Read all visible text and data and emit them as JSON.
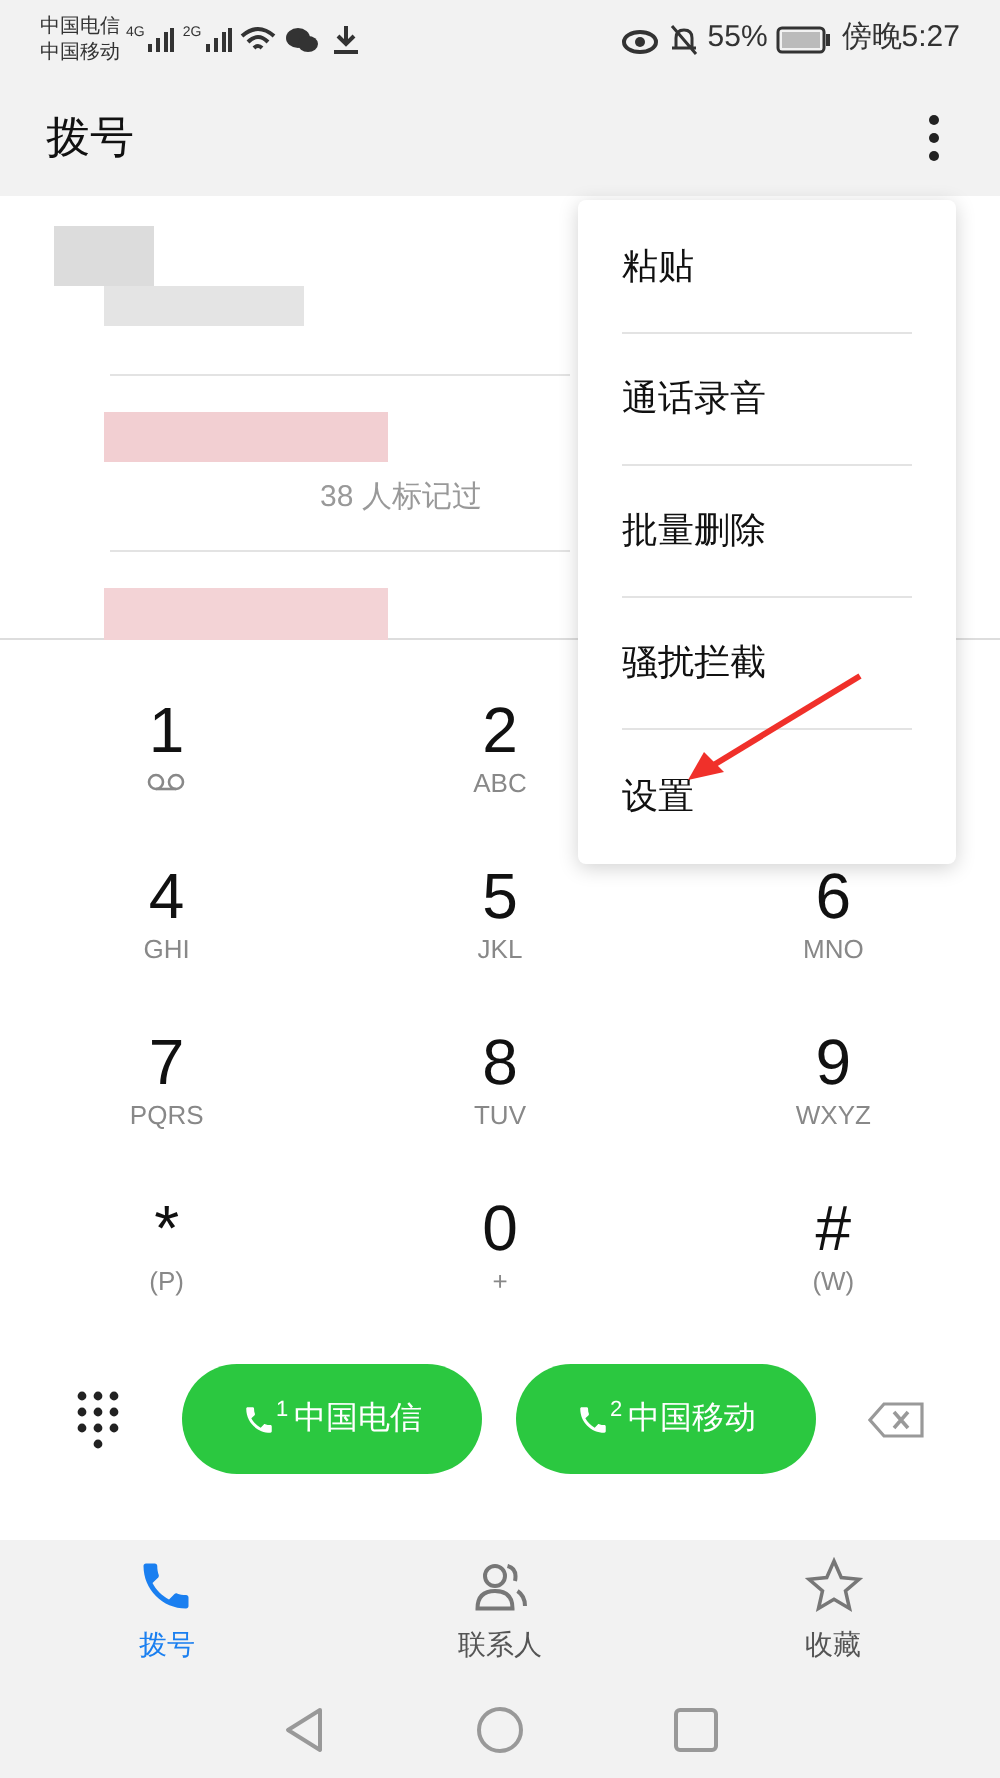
{
  "status_bar": {
    "carriers": [
      "中国电信",
      "中国移动"
    ],
    "network_types": [
      "4G",
      "2G"
    ],
    "battery": "55%",
    "time": "傍晚5:27"
  },
  "header": {
    "title": "拨号"
  },
  "call_log": {
    "note": "38 人标记过"
  },
  "menu": {
    "items": [
      {
        "label": "粘贴"
      },
      {
        "label": "通话录音"
      },
      {
        "label": "批量删除"
      },
      {
        "label": "骚扰拦截"
      },
      {
        "label": "设置"
      }
    ]
  },
  "keypad": [
    [
      {
        "digit": "1",
        "kind": "voicemail"
      },
      {
        "digit": "2",
        "sub": "ABC",
        "kind": "letters"
      }
    ],
    [
      {
        "digit": "4",
        "sub": "GHI",
        "kind": "letters"
      },
      {
        "digit": "5",
        "sub": "JKL",
        "kind": "letters"
      },
      {
        "digit": "6",
        "sub": "MNO",
        "kind": "letters"
      }
    ],
    [
      {
        "digit": "7",
        "sub": "PQRS",
        "kind": "letters"
      },
      {
        "digit": "8",
        "sub": "TUV",
        "kind": "letters"
      },
      {
        "digit": "9",
        "sub": "WXYZ",
        "kind": "letters"
      }
    ],
    [
      {
        "digit": "*",
        "sub": "(P)",
        "kind": "letters"
      },
      {
        "digit": "0",
        "sub": "+",
        "kind": "letters"
      },
      {
        "digit": "#",
        "sub": "(W)",
        "kind": "letters"
      }
    ]
  ],
  "call_buttons": [
    {
      "sim": "1",
      "label": "中国电信"
    },
    {
      "sim": "2",
      "label": "中国移动"
    }
  ],
  "bottom_tabs": [
    {
      "label": "拨号",
      "selected": true,
      "kind": "phone"
    },
    {
      "label": "联系人",
      "selected": false,
      "kind": "contacts"
    },
    {
      "label": "收藏",
      "selected": false,
      "kind": "star"
    }
  ]
}
